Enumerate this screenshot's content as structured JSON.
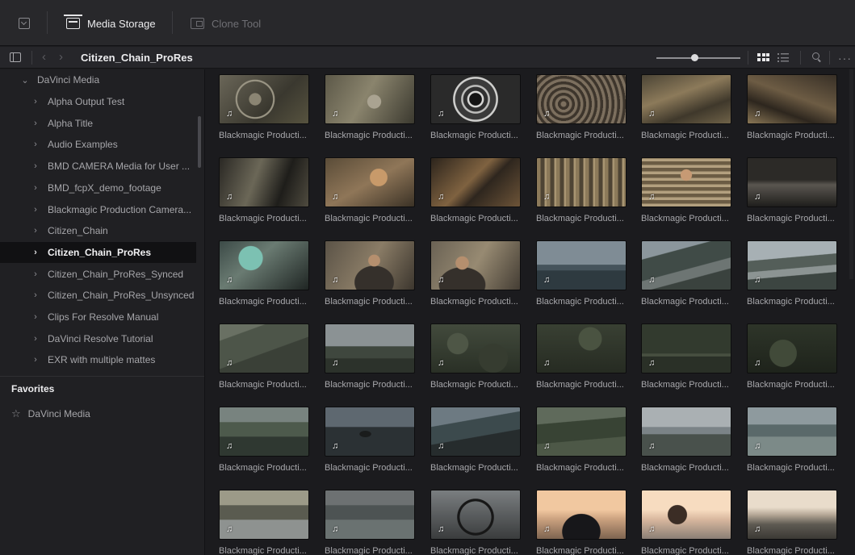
{
  "topbar": {
    "tools": [
      {
        "label": "Media Storage",
        "icon": "media-storage-icon",
        "active": true
      },
      {
        "label": "Clone Tool",
        "icon": "clone-tool-icon",
        "active": false
      }
    ]
  },
  "subbar": {
    "title": "Citizen_Chain_ProRes",
    "zoom_fraction": 0.45
  },
  "sidebar": {
    "root": "DaVinci Media",
    "items": [
      "Alpha Output Test",
      "Alpha Title",
      "Audio Examples",
      "BMD CAMERA Media for User ...",
      "BMD_fcpX_demo_footage",
      "Blackmagic Production Camera...",
      "Citizen_Chain",
      "Citizen_Chain_ProRes",
      "Citizen_Chain_ProRes_Synced",
      "Citizen_Chain_ProRes_Unsynced",
      "Clips For Resolve Manual",
      "DaVinci Resolve Tutorial",
      "EXR with multiple mattes"
    ],
    "selected_index": 7,
    "favorites_title": "Favorites",
    "favorites": [
      "DaVinci Media"
    ]
  },
  "clips": {
    "caption": "Blackmagic Producti...",
    "audio_glyph": "♫",
    "thumbs": [
      "t-bike1",
      "t-bike2",
      "t-wheel",
      "t-wheels",
      "t-bench1",
      "t-bench2",
      "t-shop1",
      "t-shop2",
      "t-shop3",
      "t-shop4",
      "t-shop5",
      "t-shop6",
      "t-helmet",
      "t-man1",
      "t-man2",
      "t-bridge",
      "t-road1",
      "t-road2",
      "t-hill1",
      "t-hill2",
      "t-brush1",
      "t-brush2",
      "t-brush3",
      "t-brush4",
      "t-coast1",
      "t-rider",
      "t-road3",
      "t-hill3",
      "t-sea1",
      "t-sea2",
      "t-sea3",
      "t-sea4",
      "t-bikeeve",
      "t-jersey",
      "t-sunset",
      "t-sunset2"
    ]
  },
  "colors": {
    "background": "#1b1b1e",
    "sidebar": "#202023",
    "selected_row": "#111113",
    "accent_text": "#ececee"
  }
}
